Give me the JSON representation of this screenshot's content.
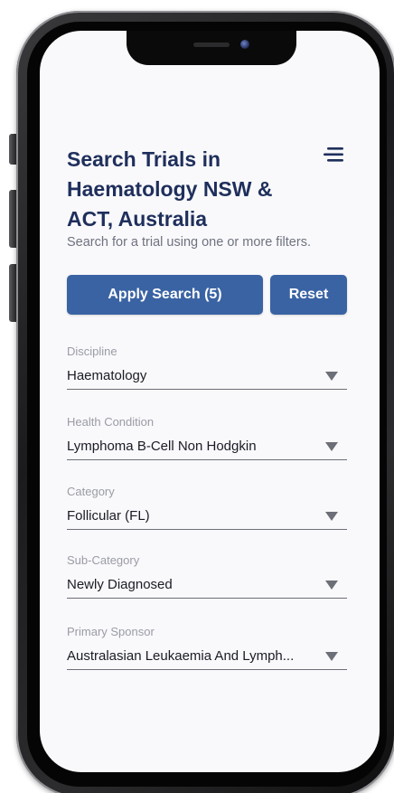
{
  "header": {
    "title": "Search Trials in Haematology NSW & ACT, Australia",
    "subtitle": "Search for a trial using one or more filters.",
    "menu_icon": "menu-icon"
  },
  "actions": {
    "apply_label": "Apply Search (5)",
    "reset_label": "Reset",
    "accent_color": "#3a63a3"
  },
  "filters": [
    {
      "label": "Discipline",
      "value": "Haematology"
    },
    {
      "label": "Health Condition",
      "value": "Lymphoma B-Cell Non Hodgkin"
    },
    {
      "label": "Category",
      "value": "Follicular (FL)"
    },
    {
      "label": "Sub-Category",
      "value": "Newly Diagnosed"
    },
    {
      "label": "Primary Sponsor",
      "value": "Australasian Leukaemia And Lymph..."
    }
  ]
}
